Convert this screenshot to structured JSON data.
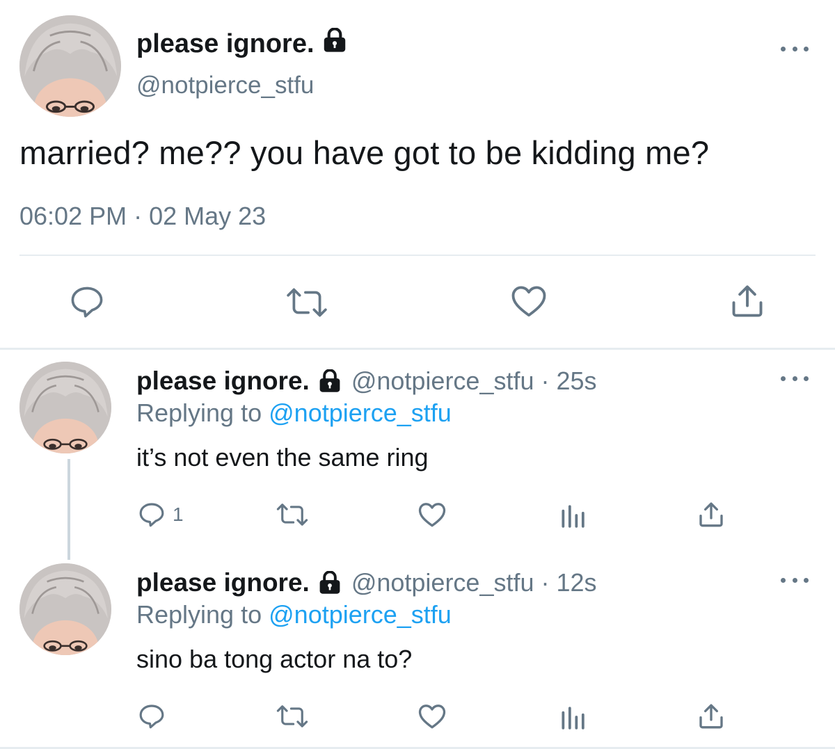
{
  "main_tweet": {
    "display_name": "please ignore.",
    "handle": "@notpierce_stfu",
    "text": "married? me?? you have got to be kidding me?",
    "timestamp": "06:02 PM · 02 May 23",
    "icons": {
      "verified_lock": "lock-icon",
      "more": "more-icon",
      "reply": "reply-icon",
      "retweet": "retweet-icon",
      "like": "heart-icon",
      "share": "share-icon"
    }
  },
  "replies": [
    {
      "display_name": "please ignore.",
      "handle_time": "@notpierce_stfu · 25s",
      "replying_prefix": "Replying to",
      "replying_to": "@notpierce_stfu",
      "text": "it’s not even the same ring",
      "reply_count": "1"
    },
    {
      "display_name": "please ignore.",
      "handle_time": "@notpierce_stfu · 12s",
      "replying_prefix": "Replying to",
      "replying_to": "@notpierce_stfu",
      "text": "sino ba tong actor na to?",
      "reply_count": ""
    }
  ],
  "colors": {
    "text_primary": "#14171a",
    "text_secondary": "#657786",
    "link": "#1da1f2",
    "divider": "#e6ecf0",
    "thread_line": "#ccd6dd"
  }
}
